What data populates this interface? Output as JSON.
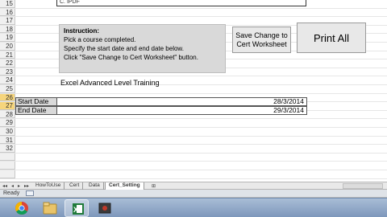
{
  "sheet": {
    "top_cell_text": "C. IPDF",
    "row_numbers": [
      "15",
      "16",
      "17",
      "18",
      "19",
      "20",
      "21",
      "22",
      "23",
      "24",
      "25",
      "26",
      "27",
      "28",
      "29",
      "30",
      "31",
      "32"
    ],
    "active_rows": [
      "24",
      "25"
    ],
    "instruction": {
      "title": "Instruction:",
      "lines": [
        "Pick a course completed.",
        "Specify the start date and end date below.",
        "Click \"Save Change to Cert Worksheet\" button."
      ]
    },
    "save_button_label": "Save Change to Cert Worksheet",
    "print_button_label": "Print All",
    "training_title": "Excel Advanced Level Training",
    "start_date": {
      "label": "Start Date",
      "value": "28/3/2014"
    },
    "end_date": {
      "label": "End Date",
      "value": "29/3/2014"
    }
  },
  "tabs": {
    "items": [
      "HowToUse",
      "Cert",
      "Data",
      "Cert_Setting"
    ],
    "active": "Cert_Setting"
  },
  "status": {
    "text": "Ready"
  },
  "taskbar": {
    "apps": [
      {
        "icon": "chrome-icon",
        "running": false
      },
      {
        "icon": "folder-icon",
        "running": false
      },
      {
        "icon": "excel-icon",
        "running": true
      },
      {
        "icon": "app-icon",
        "running": false
      }
    ]
  },
  "colors": {
    "instruction_bg": "#d9d9d9",
    "button_bg": "#e8e8e8",
    "active_row_header": "#f6d57c",
    "taskbar": "#8fa8c8"
  }
}
